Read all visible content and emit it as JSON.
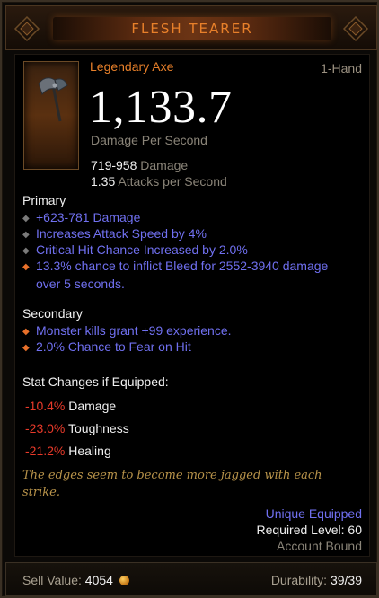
{
  "item": {
    "name": "FLESH TEARER",
    "type": "Legendary Axe",
    "hand": "1-Hand",
    "dps": "1,133.7",
    "dps_label": "Damage Per Second",
    "damage_range": "719-958",
    "damage_label": "Damage",
    "attack_speed": "1.35",
    "attack_speed_label": "Attacks per Second"
  },
  "primary": {
    "label": "Primary",
    "affixes": [
      {
        "text": "+623-781 Damage",
        "bullet": "grey"
      },
      {
        "text": "Increases Attack Speed by 4%",
        "bullet": "grey"
      },
      {
        "text": "Critical Hit Chance Increased by 2.0%",
        "bullet": "grey"
      },
      {
        "text": "13.3% chance to inflict Bleed for 2552-3940 damage",
        "cont": "over 5 seconds.",
        "bullet": "orange"
      }
    ]
  },
  "secondary": {
    "label": "Secondary",
    "affixes": [
      {
        "text": "Monster kills grant +99 experience.",
        "bullet": "orange"
      },
      {
        "text": "2.0% Chance to Fear on Hit",
        "bullet": "orange"
      }
    ]
  },
  "stat_changes": {
    "label": "Stat Changes if Equipped:",
    "rows": [
      {
        "delta": "-10.4%",
        "stat": "Damage"
      },
      {
        "delta": "-23.0%",
        "stat": "Toughness"
      },
      {
        "delta": "-21.2%",
        "stat": "Healing"
      }
    ]
  },
  "flavor": "The edges seem to become more jagged with each strike.",
  "requirements": {
    "unique_equipped": "Unique Equipped",
    "required_level": "Required Level: 60",
    "account_bound": "Account Bound"
  },
  "footer": {
    "sell_label": "Sell Value:",
    "sell_value": "4054",
    "durability_label": "Durability:",
    "durability_value": "39/39"
  },
  "colors": {
    "legendary": "#e8802a",
    "magic": "#7070f0",
    "negative": "#e83a2a",
    "flavor": "#b8934a"
  },
  "icons": {
    "item": "axe-icon",
    "coin": "gold-coin-icon",
    "primary_bullet": "grey-diamond-icon",
    "legendary_bullet": "orange-diamond-icon"
  }
}
